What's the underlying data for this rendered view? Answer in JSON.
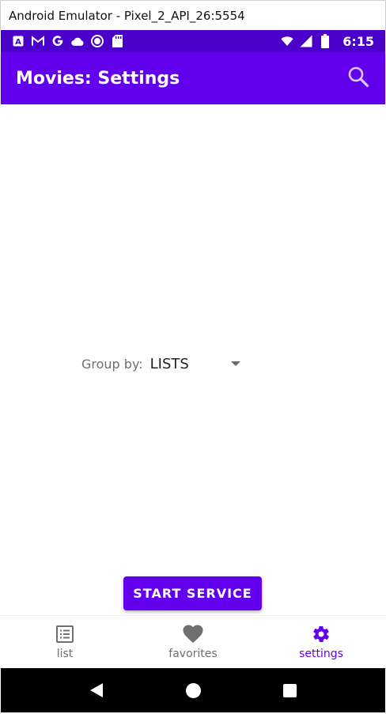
{
  "window": {
    "title": "Android Emulator - Pixel_2_API_26:5554"
  },
  "status_bar": {
    "time": "6:15",
    "left_icons": [
      "app-a-icon",
      "gmail-icon",
      "google-icon",
      "cloud-icon",
      "circle-icon",
      "sd-card-icon"
    ],
    "right_icons": [
      "wifi-icon",
      "signal-icon",
      "battery-icon"
    ],
    "color": "#4a00c9"
  },
  "app_bar": {
    "title": "Movies: Settings",
    "color": "#6200ee",
    "search_icon": "search-icon"
  },
  "settings": {
    "group_by_label": "Group by:",
    "group_by_value": "LISTS",
    "start_service_label": "START SERVICE"
  },
  "bottom_nav": {
    "active": "settings",
    "active_color": "#6200ee",
    "items": [
      {
        "label": "list",
        "icon": "list-icon"
      },
      {
        "label": "favorites",
        "icon": "heart-icon"
      },
      {
        "label": "settings",
        "icon": "gear-icon"
      }
    ]
  },
  "system_nav": {
    "buttons": [
      "back-icon",
      "home-icon",
      "recents-icon"
    ]
  }
}
